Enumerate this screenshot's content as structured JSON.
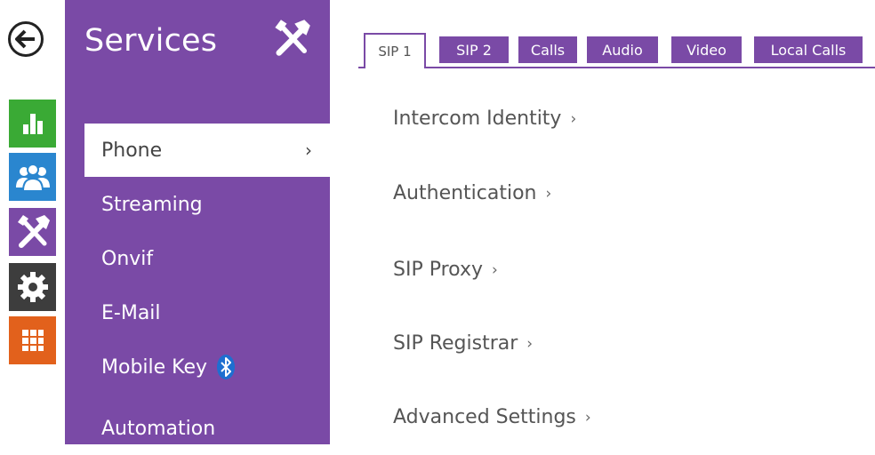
{
  "rail": {
    "colors": {
      "status": "#3aaa35",
      "directory": "#2a86cf",
      "services": "#7a4aa6",
      "hardware": "#3d3d3d",
      "system": "#e2611c"
    },
    "icons": [
      "back-icon",
      "bar-chart-icon",
      "users-icon",
      "tools-icon",
      "gear-icon",
      "grid-icon"
    ]
  },
  "sidebar": {
    "title": "Services",
    "items": [
      {
        "label": "Phone",
        "chevron": "›",
        "active": true
      },
      {
        "label": "Streaming"
      },
      {
        "label": "Onvif"
      },
      {
        "label": "E-Mail"
      },
      {
        "label": "Mobile Key"
      },
      {
        "label": "Automation"
      }
    ]
  },
  "tabs": [
    {
      "label": "SIP 1",
      "active": true
    },
    {
      "label": "SIP 2"
    },
    {
      "label": "Calls"
    },
    {
      "label": "Audio"
    },
    {
      "label": "Video"
    },
    {
      "label": "Local Calls"
    }
  ],
  "main": {
    "links": [
      {
        "label": "Intercom Identity",
        "arrow": "›"
      },
      {
        "label": "Authentication",
        "arrow": "›"
      },
      {
        "label": "SIP Proxy",
        "arrow": "›"
      },
      {
        "label": "SIP Registrar",
        "arrow": "›"
      },
      {
        "label": "Advanced Settings",
        "arrow": "›"
      }
    ]
  }
}
